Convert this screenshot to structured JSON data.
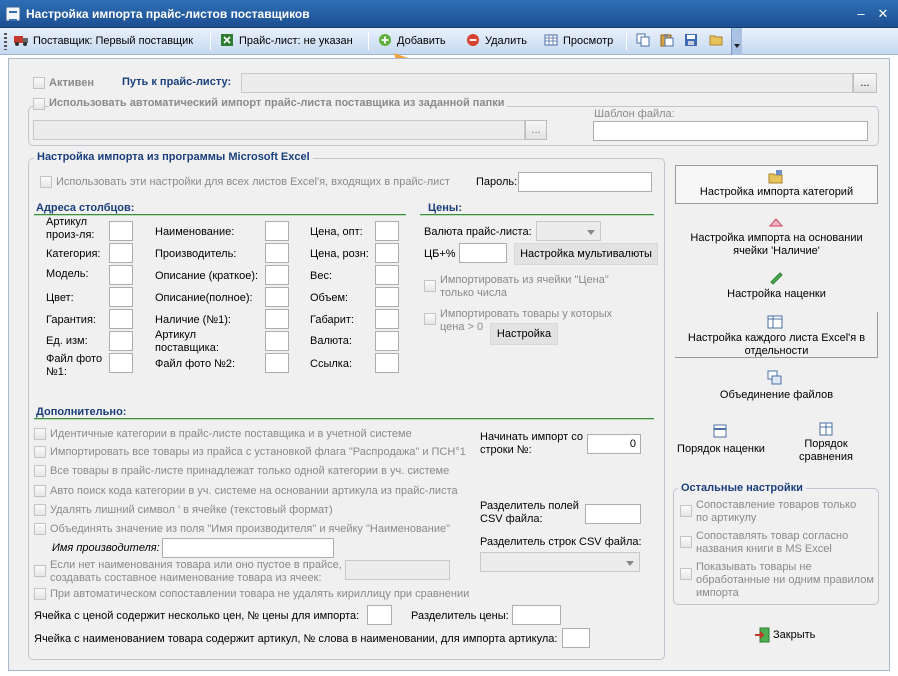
{
  "window": {
    "title": "Настройка импорта прайс-листов поставщиков",
    "minimize": "–",
    "maximize": "□",
    "close": "✕"
  },
  "toolbar": {
    "supplier": "Поставщик: Первый поставщик",
    "pricelist": "Прайс-лист: не указан",
    "add": "Добавить",
    "delete": "Удалить",
    "preview": "Просмотр"
  },
  "top": {
    "active": "Активен",
    "path_label": "Путь к прайс-листу:",
    "path_value": "",
    "browse": "...",
    "auto_import": "Использовать автоматический импорт прайс-листа поставщика из заданной папки",
    "folder_browse": "...",
    "template_label": "Шаблон файла:"
  },
  "excel": {
    "title": "Настройка импорта из программы Microsoft Excel",
    "all_sheets": "Использовать эти настройки для всех листов Excel'я, входящих в прайс-лист",
    "password_label": "Пароль:"
  },
  "columns": {
    "title": "Адреса столбцов:",
    "c1": [
      "Артикул произ-ля:",
      "Категория:",
      "Модель:",
      "Цвет:",
      "Гарантия:",
      "Ед. изм:",
      "Файл фото №1:"
    ],
    "c2": [
      "Наименование:",
      "Производитель:",
      "Описание (краткое):",
      "Описание(полное):",
      "Наличие (№1):",
      "Артикул поставщика:",
      "Файл фото №2:"
    ],
    "c3": [
      "Цена, опт:",
      "Цена, розн:",
      "Вес:",
      "Объем:",
      "Габарит:",
      "Валюта:",
      "Ссылка:"
    ]
  },
  "prices": {
    "title": "Цены:",
    "currency_label": "Валюта прайс-листа:",
    "cb_label": "ЦБ+%",
    "multicurrency": "Настройка мультивалюты",
    "numbers_only": "Импортировать из ячейки \"Цена\" только числа",
    "positive_only": "Импортировать товары у которых цена > 0",
    "setup": "Настройка"
  },
  "extra": {
    "title": "Дополнительно:",
    "options": [
      "Идентичные категории в прайс-листе поставщика и в учетной системе",
      "Импортировать все товары из прайса с установкой флага \"Распродажа\" и ПСН°1",
      "Все товары в прайс-листе принадлежат только одной категории в уч. системе",
      "Авто поиск кода категории в уч. системе на основании артикула из прайс-листа",
      "Удалять лишний символ ' в ячейке (текстовый формат)",
      "Объединять значение из поля \"Имя производителя\" и ячейку \"Наименование\""
    ],
    "manufacturer_label": "Имя производителя:",
    "composite": "Если нет наименования товара или оно пустое в прайсе, создавать составное наименование товара из ячеек:",
    "no_cyrillic": "При автоматическом сопоставлении товара не удалять кириллицу при сравнении",
    "start_row_label": "Начинать импорт со строки №:",
    "start_row_value": "0",
    "csv_field_sep": "Разделитель полей CSV файла:",
    "csv_row_sep": "Разделитель строк CSV файла:",
    "multi_price": "Ячейка с ценой содержит несколько цен, № цены для импорта:",
    "price_sep": "Разделитель цены:",
    "article_word": "Ячейка с наименованием товара содержит артикул, № слова в наименовании, для импорта артикула:"
  },
  "right": {
    "categories": "Настройка импорта категорий",
    "availability": "Настройка импорта на основании ячейки 'Наличие'",
    "markup": "Настройка наценки",
    "each_sheet": "Настройка каждого листа Excel'я в отдельности",
    "merge": "Объединение файлов",
    "markup_order": "Порядок наценки",
    "compare_order": "Порядок сравнения"
  },
  "other": {
    "title": "Остальные настройки",
    "opts": [
      "Сопоставление товаров только по артикулу",
      "Сопоставлять товар согласно названия книги в MS Excel",
      "Показывать товары не обработанные ни одним правилом импорта"
    ]
  },
  "close": "Закрыть",
  "colors": {
    "title_bar": "#2f6fb5",
    "section_header": "#1b3f7d",
    "group_line": "#3d8d3d"
  }
}
